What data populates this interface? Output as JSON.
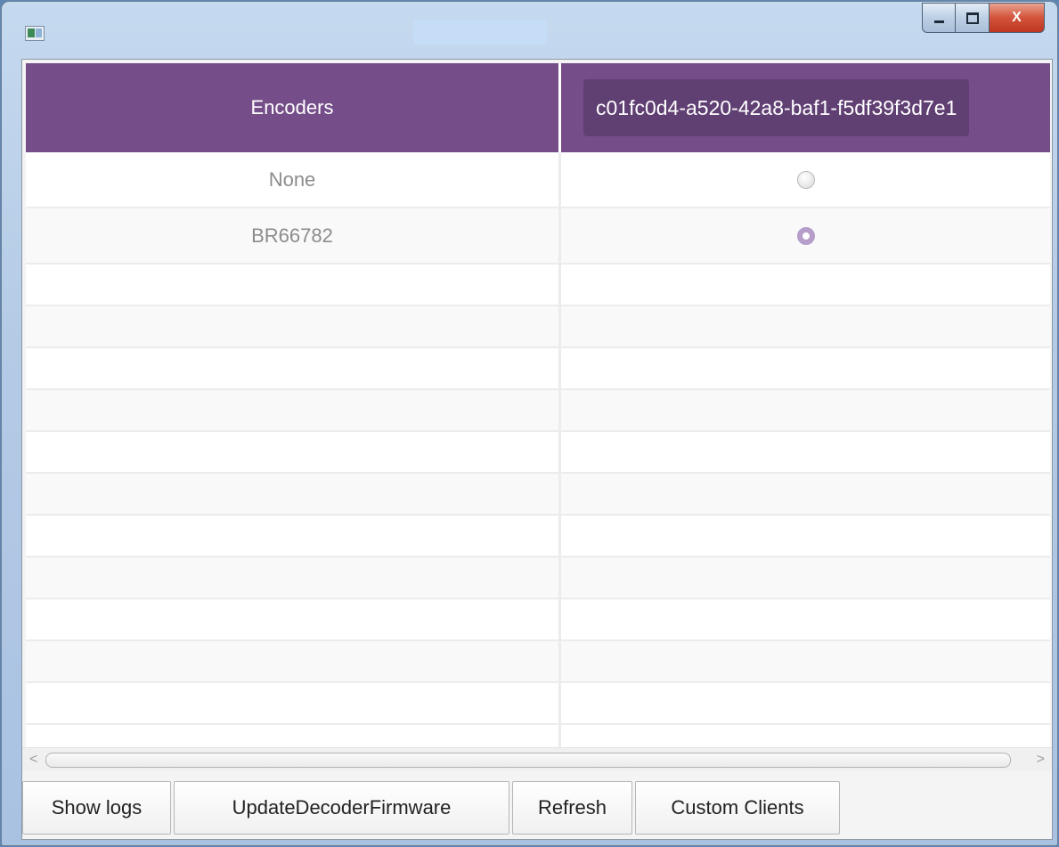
{
  "window": {
    "caption_buttons": {
      "minimize_icon": "minimize-icon",
      "maximize_icon": "maximize-icon",
      "close_glyph": "X"
    }
  },
  "table": {
    "headers": {
      "encoders": "Encoders",
      "decoder_id": "c01fc0d4-a520-42a8-baf1-f5df39f3d7e1"
    },
    "rows": [
      {
        "encoder": "None",
        "selected": false
      },
      {
        "encoder": "BR66782",
        "selected": true
      }
    ],
    "accent_color": "#744d89"
  },
  "scrollbar": {
    "left_arrow": "<",
    "right_arrow": ">"
  },
  "toolbar": {
    "show_logs": "Show logs",
    "update_firmware": "UpdateDecoderFirmware",
    "refresh": "Refresh",
    "custom_clients": "Custom Clients"
  }
}
